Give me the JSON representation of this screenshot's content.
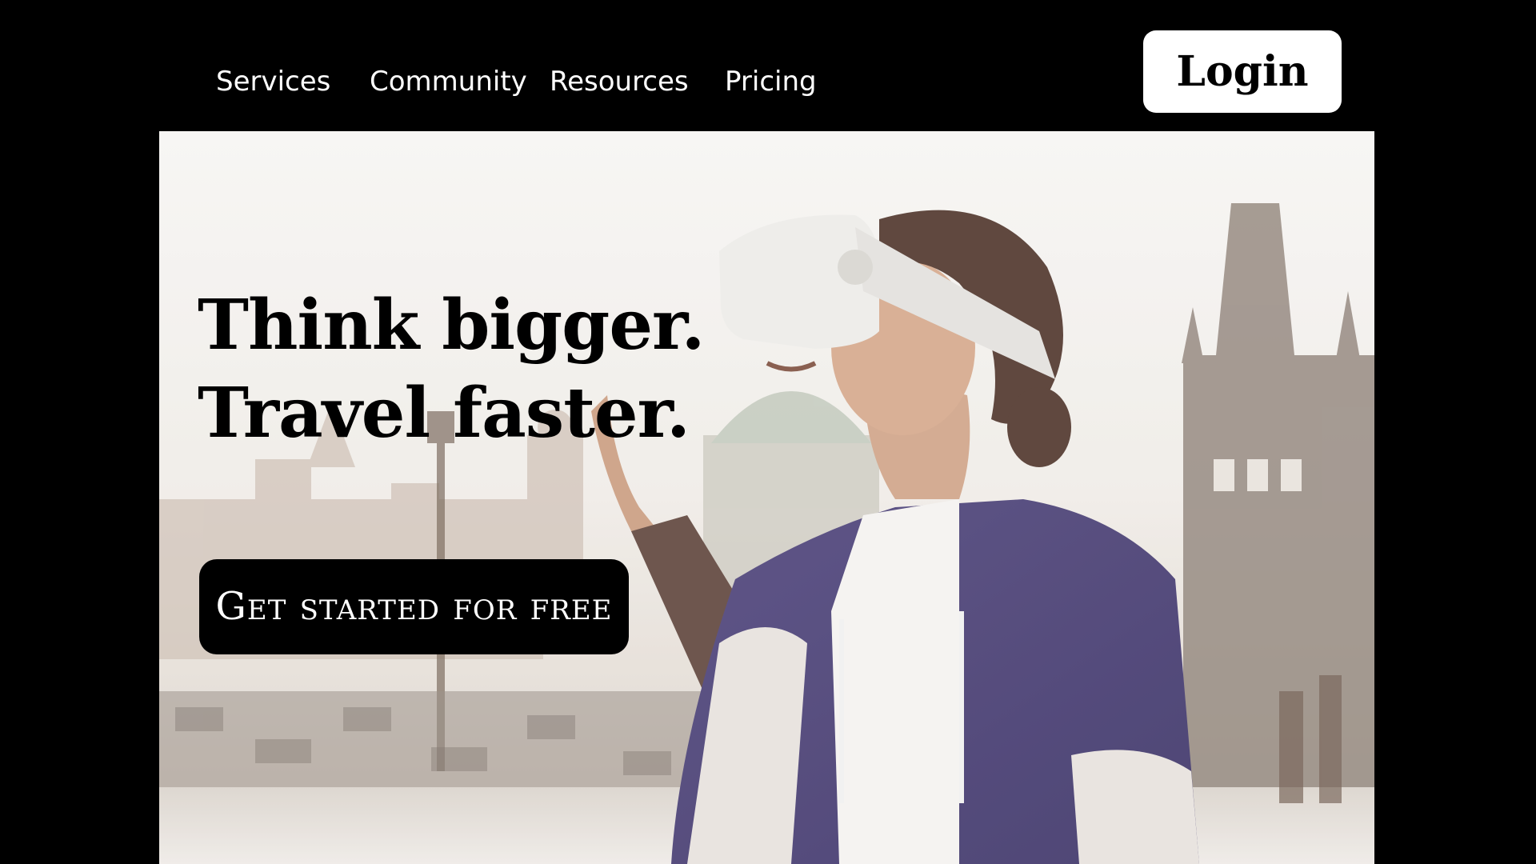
{
  "nav": {
    "items": [
      {
        "label": "Services"
      },
      {
        "label": "Community"
      },
      {
        "label": "Resources"
      },
      {
        "label": "Pricing"
      }
    ],
    "login_label": "Login"
  },
  "hero": {
    "headline_line1": "Think bigger.",
    "headline_line2": "Travel faster.",
    "cta_label": "Get started for free",
    "image_description_icon": "vr-headset-woman-photo"
  },
  "colors": {
    "background": "#000000",
    "nav_text": "#ffffff",
    "login_bg": "#ffffff",
    "login_text": "#000000",
    "cta_bg": "#000000",
    "cta_text": "#ffffff",
    "headline": "#000000"
  }
}
